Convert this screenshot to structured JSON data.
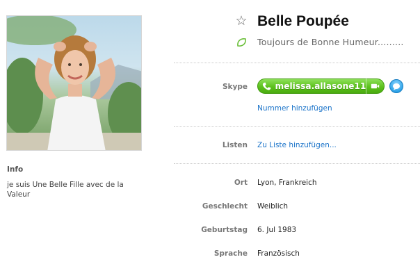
{
  "profile": {
    "display_name": "Belle Poupée",
    "mood_message": "Toujours de Bonne Humeur.........",
    "favorite_icon": "star-outline-icon",
    "mood_icon": "leaf-icon"
  },
  "info": {
    "title": "Info",
    "text": "je suis Une Belle Fille avec de la Valeur"
  },
  "skype": {
    "label": "Skype",
    "handle": "melissa.allasone11",
    "add_number_link": "Nummer hinzufügen",
    "call_icon": "phone-icon",
    "video_icon": "video-camera-icon",
    "chat_icon": "chat-bubble-icon",
    "accent_color": "#5cc11c",
    "chat_color": "#2ea3e8"
  },
  "lists": {
    "label": "Listen",
    "add_link": "Zu Liste hinzufügen..."
  },
  "details": {
    "location_label": "Ort",
    "location_value": "Lyon, Frankreich",
    "gender_label": "Geschlecht",
    "gender_value": "Weiblich",
    "birthday_label": "Geburtstag",
    "birthday_value": "6. Jul 1983",
    "language_label": "Sprache",
    "language_value": "Französisch"
  },
  "colors": {
    "link": "#1a73c9",
    "label": "#777777"
  }
}
